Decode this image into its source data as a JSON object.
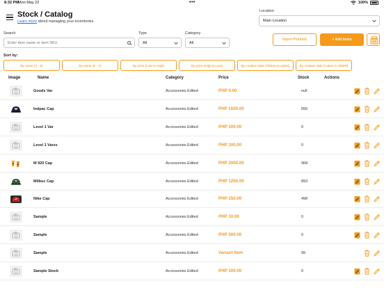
{
  "status_bar": {
    "time": "8:32 PM",
    "date": "Mon May 22",
    "battery": "100%"
  },
  "header": {
    "title": "Stock / Catalog",
    "learn_more": "Learn more",
    "subtitle_rest": " about managing your inventories",
    "location_label": "Location",
    "location_value": "Main Location"
  },
  "filters": {
    "search_label": "Search",
    "search_placeholder": "Enter item name or item SKU",
    "type_label": "Type",
    "type_value": "All",
    "category_label": "Category",
    "category_value": "All"
  },
  "toolbar": {
    "import_label": "Import Products",
    "add_label": "+ Add Items"
  },
  "sort": {
    "label": "Sort by:",
    "options": [
      "By name (A - Z)",
      "By name (Z - A)",
      "By price (Low to High)",
      "By price (High to Low)",
      "By creation date (Oldest to Latest)",
      "By creation date (Latest to Oldest)"
    ]
  },
  "table": {
    "columns": [
      "Image",
      "Name",
      "Category",
      "Price",
      "Stock",
      "Actions"
    ],
    "rows": [
      {
        "image": "camera-placeholder-icon",
        "name": "Goods Var",
        "category": "Accessories Edited",
        "price": "PHP 0.00",
        "stock": "null",
        "editable": true
      },
      {
        "image": "cap-photo-icon",
        "name": "Indpac Cap",
        "category": "Accessories Edited",
        "price": "PHP 1500.00",
        "stock": "656",
        "editable": true
      },
      {
        "image": "camera-placeholder-icon",
        "name": "Level 1 Var",
        "category": "Accessories Edited",
        "price": "PHP 100.00",
        "stock": "0",
        "editable": true
      },
      {
        "image": "camera-placeholder-icon",
        "name": "Level 1 Varzs",
        "category": "Accessories Edited",
        "price": "PHP 100.00",
        "stock": "0",
        "editable": true
      },
      {
        "image": "orange-items-icon",
        "name": "M 920 Cap",
        "category": "Accessories Edited",
        "price": "PHP 2000.00",
        "stock": "968",
        "editable": true
      },
      {
        "image": "green-cap-photo-icon",
        "name": "Milbuc Cap",
        "category": "Accessories Edited",
        "price": "PHP 1250.00",
        "stock": "893",
        "editable": true
      },
      {
        "image": "red-cap-photo-icon",
        "name": "Nike Cap",
        "category": "Accessories Edited",
        "price": "PHP 150.00",
        "stock": "498",
        "editable": true
      },
      {
        "image": "camera-placeholder-icon",
        "name": "Sample",
        "category": "Accessories Edited",
        "price": "PHP 10.00",
        "stock": "0",
        "editable": true
      },
      {
        "image": "camera-placeholder-icon",
        "name": "Sample",
        "category": "Accessories Edited",
        "price": "PHP 500.00",
        "stock": "0",
        "editable": true
      },
      {
        "image": "camera-placeholder-icon",
        "name": "Sample",
        "category": "Accessories Edited",
        "price": "Variant Item",
        "stock": "99",
        "editable": false
      },
      {
        "image": "camera-placeholder-icon",
        "name": "Sample Stock",
        "category": "Accessories Edited",
        "price": "PHP 100.00",
        "stock": "0",
        "editable": true
      }
    ]
  },
  "colors": {
    "accent": "#f59a1b",
    "link": "#2a6ad8"
  }
}
